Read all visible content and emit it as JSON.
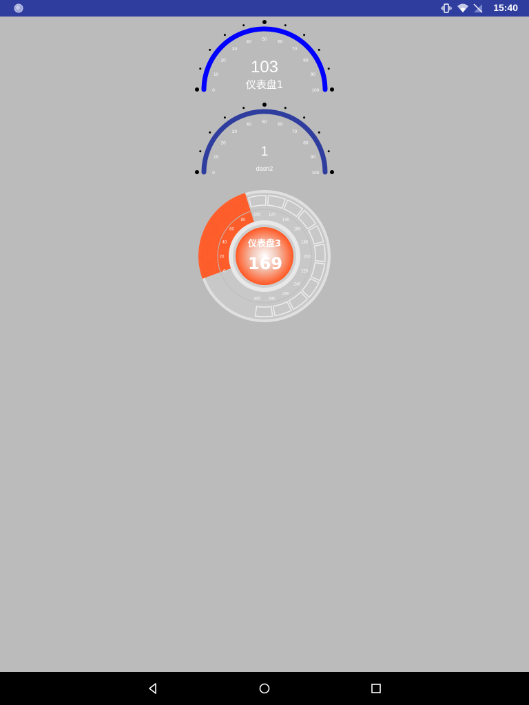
{
  "status_bar": {
    "time": "15:40",
    "left_icon": "app-notification-icon",
    "icons": [
      "vibrate-icon",
      "wifi-icon",
      "no-signal-icon"
    ],
    "background": "#2f3e9e"
  },
  "gauges": [
    {
      "id": "dash1",
      "value": "103",
      "label": "仪表盘1",
      "min": 0,
      "max": 100,
      "ticks": [
        "0",
        "10",
        "20",
        "30",
        "40",
        "50",
        "60",
        "70",
        "80",
        "90",
        "100"
      ],
      "arc_color": "#0000ff"
    },
    {
      "id": "dash2",
      "value": "1",
      "label": "dash2",
      "min": 0,
      "max": 100,
      "ticks": [
        "0",
        "10",
        "20",
        "30",
        "40",
        "50",
        "60",
        "70",
        "80",
        "90",
        "100"
      ],
      "arc_color": "#2f3e9e"
    },
    {
      "id": "dash3",
      "value": "169",
      "label": "仪表盘3",
      "min": 0,
      "max": 300,
      "ticks": [
        "0",
        "20",
        "40",
        "60",
        "80",
        "100",
        "120",
        "140",
        "160",
        "180",
        "200",
        "220",
        "240",
        "260",
        "280",
        "300"
      ],
      "accent_color": "#ff5722"
    }
  ],
  "nav_bar": {
    "buttons": [
      "back-icon",
      "home-icon",
      "recents-icon"
    ]
  }
}
